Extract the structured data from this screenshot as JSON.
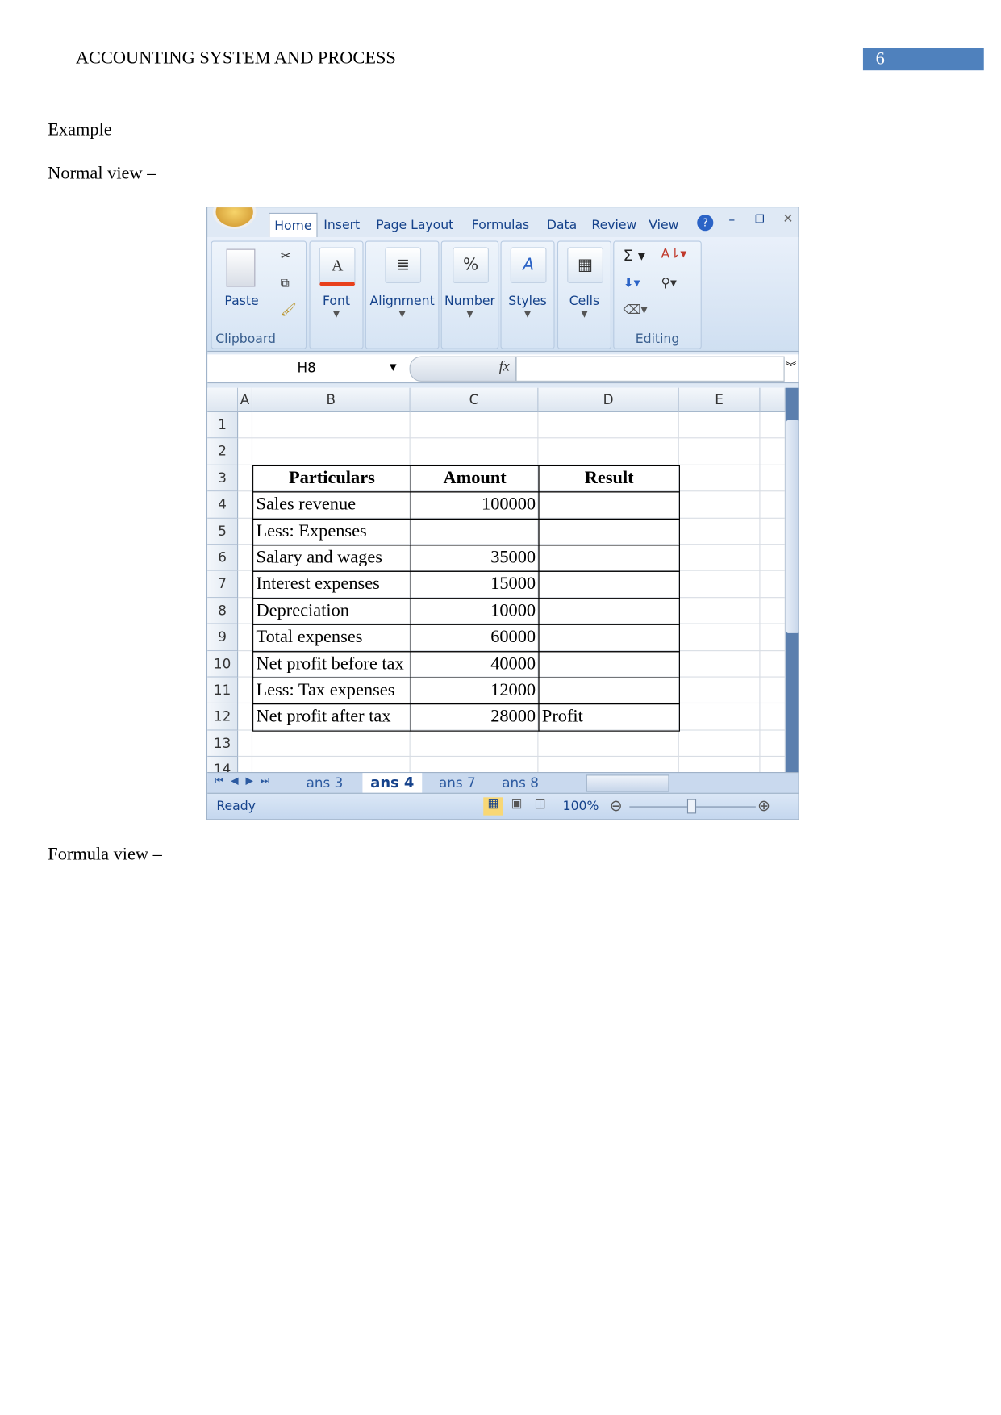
{
  "header": {
    "title": "ACCOUNTING SYSTEM AND PROCESS",
    "page_number": "6",
    "accent": "#4f81bd"
  },
  "body": {
    "example": "Example",
    "normal_view": "Normal view –",
    "formula_view": "Formula view –"
  },
  "excel": {
    "ribbon_tabs": [
      "Home",
      "Insert",
      "Page Layout",
      "Formulas",
      "Data",
      "Review",
      "View"
    ],
    "active_tab": "Home",
    "groups": {
      "paste": "Paste",
      "clipboard": "Clipboard",
      "font": "Font",
      "alignment": "Alignment",
      "number": "Number",
      "styles": "Styles",
      "cells": "Cells",
      "editing": "Editing"
    },
    "name_box": "H8",
    "fx": "fx",
    "columns": [
      "A",
      "B",
      "C",
      "D",
      "E"
    ],
    "rows": [
      "1",
      "2",
      "3",
      "4",
      "5",
      "6",
      "7",
      "8",
      "9",
      "10",
      "11",
      "12",
      "13",
      "14"
    ],
    "table": {
      "headers": [
        "Particulars",
        "Amount",
        "Result"
      ],
      "rows": [
        [
          "Sales revenue",
          "100000",
          ""
        ],
        [
          "Less: Expenses",
          "",
          ""
        ],
        [
          "Salary and wages",
          "35000",
          ""
        ],
        [
          "Interest expenses",
          "15000",
          ""
        ],
        [
          "Depreciation",
          "10000",
          ""
        ],
        [
          "Total expenses",
          "60000",
          ""
        ],
        [
          "Net profit before tax",
          "40000",
          ""
        ],
        [
          "Less: Tax expenses",
          "12000",
          ""
        ],
        [
          "Net profit after tax",
          "28000",
          "Profit"
        ]
      ]
    },
    "sheet_tabs": [
      "ans 3",
      "ans 4",
      "ans 7",
      "ans 8"
    ],
    "active_sheet": "ans 4",
    "status": "Ready",
    "zoom": "100%"
  }
}
